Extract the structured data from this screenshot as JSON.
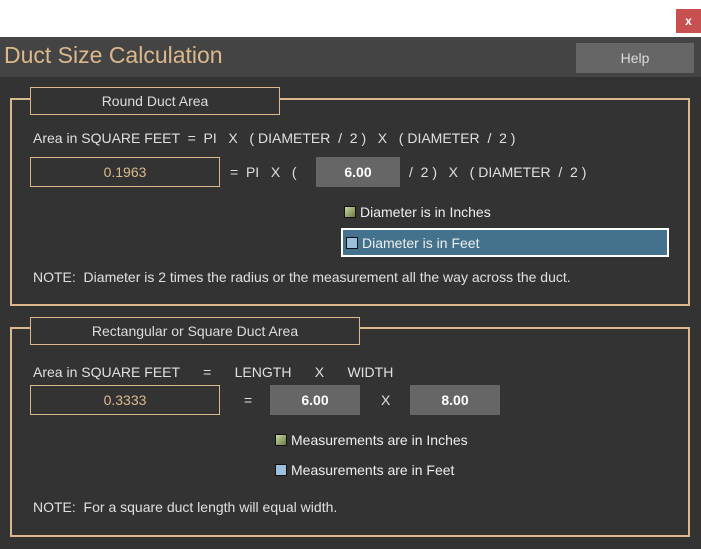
{
  "window": {
    "close_label": "x",
    "title": "Duct Size Calculation",
    "help_label": "Help"
  },
  "round": {
    "legend": "Round Duct Area",
    "formula": "Area in SQUARE FEET  =  PI   X   ( DIAMETER  /  2 )   X   ( DIAMETER  /  2 )",
    "result": "0.1963",
    "eq_pre": "=  PI   X   (",
    "diameter": "6.00",
    "eq_post": "/  2 )   X   ( DIAMETER  /  2 )",
    "options": [
      "Diameter is in Inches",
      "Diameter is in Feet"
    ],
    "selected": 1,
    "note": "NOTE:  Diameter is 2 times the radius or the measurement all the way across the duct."
  },
  "rect": {
    "legend": "Rectangular or Square Duct Area",
    "formula": "Area in SQUARE FEET      =      LENGTH      X      WIDTH",
    "result": "0.3333",
    "eq": "=",
    "length": "6.00",
    "x": "X",
    "width": "8.00",
    "options": [
      "Measurements are in Inches",
      "Measurements are in Feet"
    ],
    "note": "NOTE:  For a square duct length will equal width."
  }
}
